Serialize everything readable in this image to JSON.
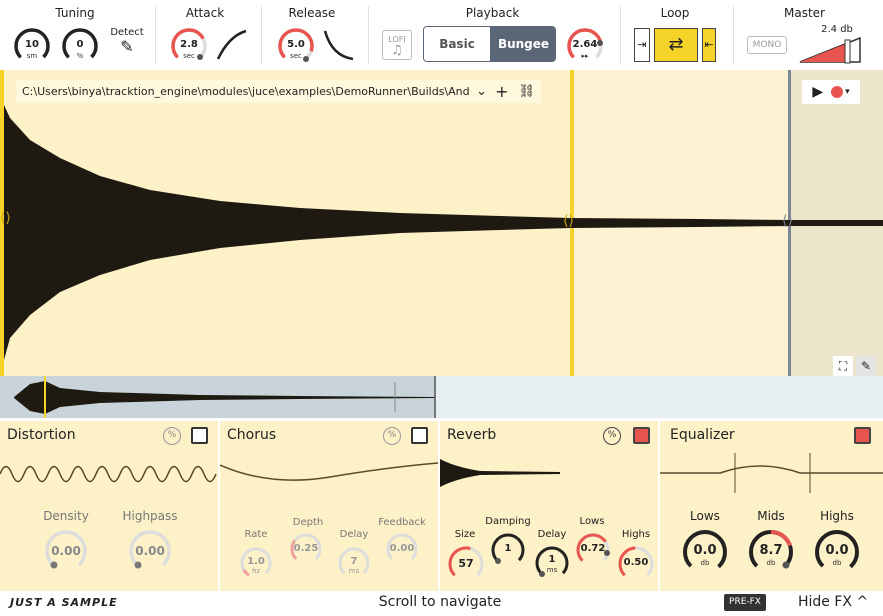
{
  "top": {
    "tuning": {
      "title": "Tuning",
      "knob1": {
        "value": "10",
        "unit": "sm"
      },
      "knob2": {
        "value": "0",
        "unit": "%"
      },
      "detect": "Detect"
    },
    "attack": {
      "title": "Attack",
      "knob": {
        "value": "2.8",
        "unit": "sec"
      }
    },
    "release": {
      "title": "Release",
      "knob": {
        "value": "5.0",
        "unit": "sec"
      }
    },
    "playback": {
      "title": "Playback",
      "lofi": "LOFI",
      "basic": "Basic",
      "bungee": "Bungee",
      "speed": {
        "value": "2.64",
        "unit": "▸▸"
      }
    },
    "loop": {
      "title": "Loop"
    },
    "master": {
      "title": "Master",
      "mono": "MONO",
      "gain": "2.4 db"
    }
  },
  "waveform": {
    "path": "C:\\Users\\binya\\tracktion_engine\\modules\\juce\\examples\\DemoRunner\\Builds\\Androi..."
  },
  "fx": {
    "distortion": {
      "title": "Distortion",
      "density": {
        "label": "Density",
        "value": "0.00"
      },
      "highpass": {
        "label": "Highpass",
        "value": "0.00"
      }
    },
    "chorus": {
      "title": "Chorus",
      "rate": {
        "label": "Rate",
        "value": "1.0",
        "unit": "hz"
      },
      "depth": {
        "label": "Depth",
        "value": "0.25"
      },
      "delay": {
        "label": "Delay",
        "value": "7",
        "unit": "ms"
      },
      "feedback": {
        "label": "Feedback",
        "value": "0.00"
      }
    },
    "reverb": {
      "title": "Reverb",
      "size": {
        "label": "Size",
        "value": "57"
      },
      "damping": {
        "label": "Damping",
        "value": "1"
      },
      "delay": {
        "label": "Delay",
        "value": "1",
        "unit": "ms"
      },
      "lows": {
        "label": "Lows",
        "value": "0.72"
      },
      "highs": {
        "label": "Highs",
        "value": "0.50"
      }
    },
    "equalizer": {
      "title": "Equalizer",
      "lows": {
        "label": "Lows",
        "value": "0.0",
        "unit": "db"
      },
      "mids": {
        "label": "Mids",
        "value": "8.7",
        "unit": "db"
      },
      "highs": {
        "label": "Highs",
        "value": "0.0",
        "unit": "db"
      }
    }
  },
  "footer": {
    "brand": "JUST A SAMPLE",
    "hint": "Scroll to navigate",
    "prefx": "PRE-FX",
    "hidefx": "Hide FX",
    "caret": "^"
  },
  "colors": {
    "accent": "#e8544e",
    "loop": "#f5d328",
    "wave_bg": "#fdf1c8",
    "bungee": "#5a6577"
  }
}
